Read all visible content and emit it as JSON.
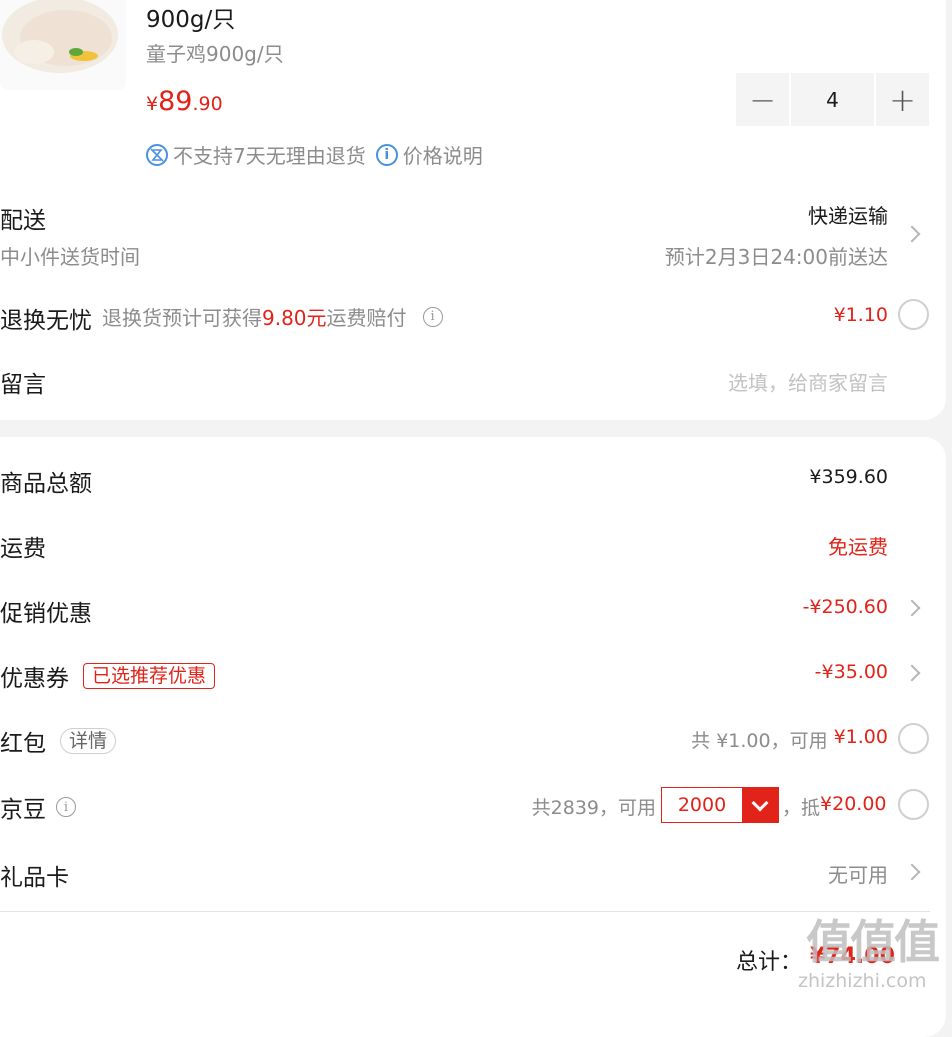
{
  "product": {
    "title": "900g/只",
    "spec": "童子鸡900g/只",
    "price_symbol": "¥",
    "price_int": "89",
    "price_dec": ".90",
    "quantity": "4",
    "minus": "−",
    "plus": "+",
    "no_return_text": "不支持7天无理由退货",
    "price_note_text": "价格说明"
  },
  "delivery": {
    "label": "配送",
    "sublabel": "中小件送货时间",
    "method": "快递运输",
    "eta": "预计2月3日24:00前送达"
  },
  "return_worry_free": {
    "label": "退换无忧",
    "desc_prefix": "退换货预计可获得",
    "desc_amount": "9.80元",
    "desc_suffix": "运费赔付",
    "price": "¥1.10"
  },
  "message": {
    "label": "留言",
    "placeholder": "选填，给商家留言"
  },
  "summary": {
    "goods_total_label": "商品总额",
    "goods_total_value": "¥359.60",
    "shipping_label": "运费",
    "shipping_value": "免运费",
    "promo_label": "促销优惠",
    "promo_value": "-¥250.60",
    "coupon_label": "优惠券",
    "coupon_tag": "已选推荐优惠",
    "coupon_value": "-¥35.00",
    "redpacket_label": "红包",
    "redpacket_tag": "详情",
    "redpacket_info": "共 ¥1.00，可用",
    "redpacket_value": "¥1.00",
    "jd_bean_label": "京豆",
    "jd_bean_info": "共2839，可用",
    "jd_bean_select": "2000",
    "jd_bean_deduct_prefix": "，抵",
    "jd_bean_deduct": "¥20.00",
    "gift_card_label": "礼品卡",
    "gift_card_value": "无可用"
  },
  "total": {
    "label": "总计：",
    "value": "¥74.00"
  },
  "watermark": {
    "logo": "值值值",
    "site": "zhizhizhi.com"
  },
  "colors": {
    "accent_red": "#e2231a",
    "info_blue": "#4a90e2",
    "page_bg": "#f3f3f3"
  }
}
